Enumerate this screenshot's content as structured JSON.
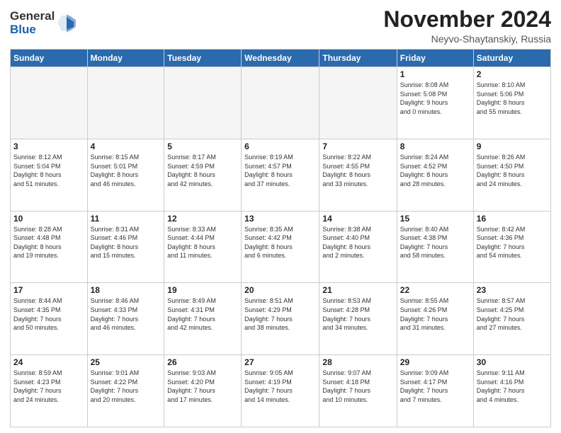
{
  "header": {
    "logo_line1": "General",
    "logo_line2": "Blue",
    "month": "November 2024",
    "location": "Neyvo-Shaytanskiy, Russia"
  },
  "weekdays": [
    "Sunday",
    "Monday",
    "Tuesday",
    "Wednesday",
    "Thursday",
    "Friday",
    "Saturday"
  ],
  "weeks": [
    [
      {
        "day": "",
        "info": ""
      },
      {
        "day": "",
        "info": ""
      },
      {
        "day": "",
        "info": ""
      },
      {
        "day": "",
        "info": ""
      },
      {
        "day": "",
        "info": ""
      },
      {
        "day": "1",
        "info": "Sunrise: 8:08 AM\nSunset: 5:08 PM\nDaylight: 9 hours\nand 0 minutes."
      },
      {
        "day": "2",
        "info": "Sunrise: 8:10 AM\nSunset: 5:06 PM\nDaylight: 8 hours\nand 55 minutes."
      }
    ],
    [
      {
        "day": "3",
        "info": "Sunrise: 8:12 AM\nSunset: 5:04 PM\nDaylight: 8 hours\nand 51 minutes."
      },
      {
        "day": "4",
        "info": "Sunrise: 8:15 AM\nSunset: 5:01 PM\nDaylight: 8 hours\nand 46 minutes."
      },
      {
        "day": "5",
        "info": "Sunrise: 8:17 AM\nSunset: 4:59 PM\nDaylight: 8 hours\nand 42 minutes."
      },
      {
        "day": "6",
        "info": "Sunrise: 8:19 AM\nSunset: 4:57 PM\nDaylight: 8 hours\nand 37 minutes."
      },
      {
        "day": "7",
        "info": "Sunrise: 8:22 AM\nSunset: 4:55 PM\nDaylight: 8 hours\nand 33 minutes."
      },
      {
        "day": "8",
        "info": "Sunrise: 8:24 AM\nSunset: 4:52 PM\nDaylight: 8 hours\nand 28 minutes."
      },
      {
        "day": "9",
        "info": "Sunrise: 8:26 AM\nSunset: 4:50 PM\nDaylight: 8 hours\nand 24 minutes."
      }
    ],
    [
      {
        "day": "10",
        "info": "Sunrise: 8:28 AM\nSunset: 4:48 PM\nDaylight: 8 hours\nand 19 minutes."
      },
      {
        "day": "11",
        "info": "Sunrise: 8:31 AM\nSunset: 4:46 PM\nDaylight: 8 hours\nand 15 minutes."
      },
      {
        "day": "12",
        "info": "Sunrise: 8:33 AM\nSunset: 4:44 PM\nDaylight: 8 hours\nand 11 minutes."
      },
      {
        "day": "13",
        "info": "Sunrise: 8:35 AM\nSunset: 4:42 PM\nDaylight: 8 hours\nand 6 minutes."
      },
      {
        "day": "14",
        "info": "Sunrise: 8:38 AM\nSunset: 4:40 PM\nDaylight: 8 hours\nand 2 minutes."
      },
      {
        "day": "15",
        "info": "Sunrise: 8:40 AM\nSunset: 4:38 PM\nDaylight: 7 hours\nand 58 minutes."
      },
      {
        "day": "16",
        "info": "Sunrise: 8:42 AM\nSunset: 4:36 PM\nDaylight: 7 hours\nand 54 minutes."
      }
    ],
    [
      {
        "day": "17",
        "info": "Sunrise: 8:44 AM\nSunset: 4:35 PM\nDaylight: 7 hours\nand 50 minutes."
      },
      {
        "day": "18",
        "info": "Sunrise: 8:46 AM\nSunset: 4:33 PM\nDaylight: 7 hours\nand 46 minutes."
      },
      {
        "day": "19",
        "info": "Sunrise: 8:49 AM\nSunset: 4:31 PM\nDaylight: 7 hours\nand 42 minutes."
      },
      {
        "day": "20",
        "info": "Sunrise: 8:51 AM\nSunset: 4:29 PM\nDaylight: 7 hours\nand 38 minutes."
      },
      {
        "day": "21",
        "info": "Sunrise: 8:53 AM\nSunset: 4:28 PM\nDaylight: 7 hours\nand 34 minutes."
      },
      {
        "day": "22",
        "info": "Sunrise: 8:55 AM\nSunset: 4:26 PM\nDaylight: 7 hours\nand 31 minutes."
      },
      {
        "day": "23",
        "info": "Sunrise: 8:57 AM\nSunset: 4:25 PM\nDaylight: 7 hours\nand 27 minutes."
      }
    ],
    [
      {
        "day": "24",
        "info": "Sunrise: 8:59 AM\nSunset: 4:23 PM\nDaylight: 7 hours\nand 24 minutes."
      },
      {
        "day": "25",
        "info": "Sunrise: 9:01 AM\nSunset: 4:22 PM\nDaylight: 7 hours\nand 20 minutes."
      },
      {
        "day": "26",
        "info": "Sunrise: 9:03 AM\nSunset: 4:20 PM\nDaylight: 7 hours\nand 17 minutes."
      },
      {
        "day": "27",
        "info": "Sunrise: 9:05 AM\nSunset: 4:19 PM\nDaylight: 7 hours\nand 14 minutes."
      },
      {
        "day": "28",
        "info": "Sunrise: 9:07 AM\nSunset: 4:18 PM\nDaylight: 7 hours\nand 10 minutes."
      },
      {
        "day": "29",
        "info": "Sunrise: 9:09 AM\nSunset: 4:17 PM\nDaylight: 7 hours\nand 7 minutes."
      },
      {
        "day": "30",
        "info": "Sunrise: 9:11 AM\nSunset: 4:16 PM\nDaylight: 7 hours\nand 4 minutes."
      }
    ]
  ]
}
